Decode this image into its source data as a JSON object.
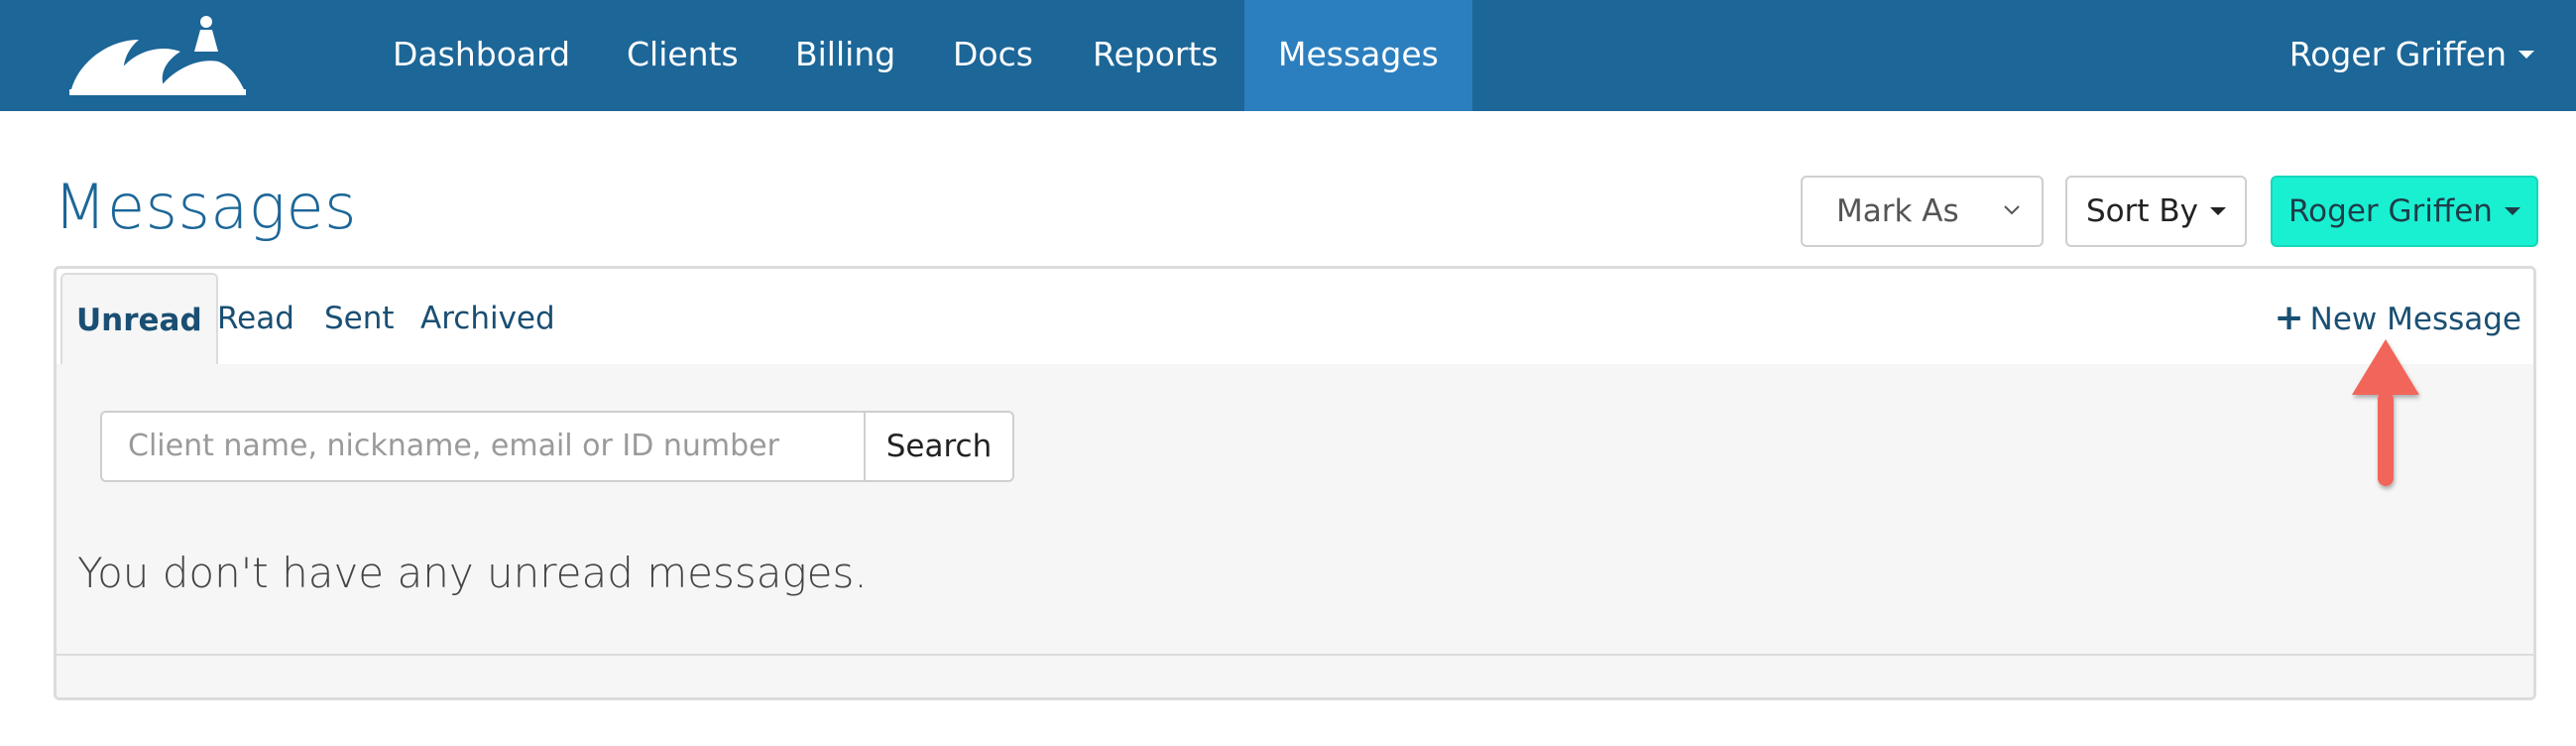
{
  "navbar": {
    "items": [
      {
        "label": "Dashboard"
      },
      {
        "label": "Clients"
      },
      {
        "label": "Billing"
      },
      {
        "label": "Docs"
      },
      {
        "label": "Reports"
      },
      {
        "label": "Messages",
        "active": true
      }
    ],
    "user": "Roger Griffen"
  },
  "page": {
    "title": "Messages"
  },
  "controls": {
    "mark_as": "Mark As",
    "sort_by": "Sort By",
    "user_button": "Roger Griffen"
  },
  "tabs": [
    {
      "label": "Unread",
      "active": true
    },
    {
      "label": "Read"
    },
    {
      "label": "Sent"
    },
    {
      "label": "Archived"
    }
  ],
  "new_message": "New Message",
  "search": {
    "placeholder": "Client name, nickname, email or ID number",
    "button": "Search"
  },
  "empty_text": "You don't have any unread messages.",
  "colors": {
    "navbar": "#1c6698",
    "active_nav": "#2c7fbe",
    "user_button": "#19f0d2",
    "arrow": "#f2655a"
  },
  "icons": [
    "logo-icon",
    "caret-down-icon",
    "chevron-down-icon",
    "plus-icon",
    "arrow-up-icon"
  ]
}
